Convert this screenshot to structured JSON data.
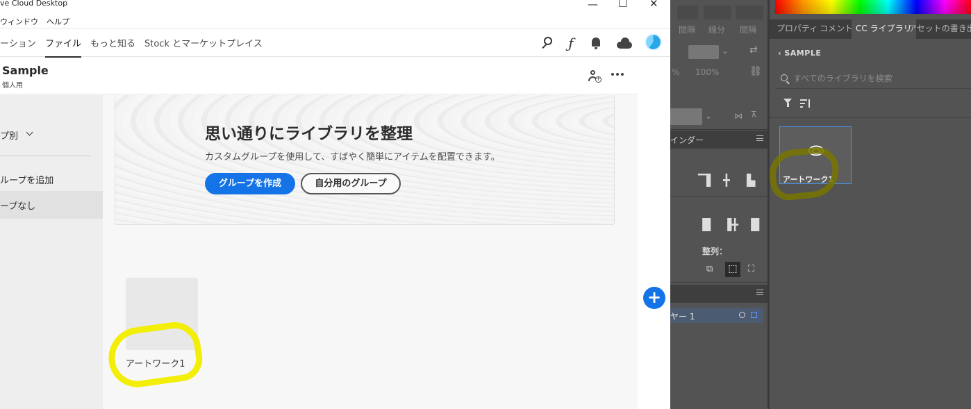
{
  "cc_window": {
    "title": "ve Cloud Desktop",
    "menu": [
      "ウィンドウ",
      "ヘルプ"
    ],
    "nav_tabs": [
      "ーション",
      "ファイル",
      "もっと知る",
      "Stock とマーケットプレイス"
    ],
    "nav_icons": [
      "search-icon",
      "fonts-icon",
      "bell-icon",
      "cloud-icon",
      "avatar"
    ],
    "library": {
      "name": "Sample",
      "subtitle": "個人用"
    },
    "leftnav": {
      "group_by": "プ別",
      "add_group": "ループを追加",
      "no_group": "ープなし"
    },
    "banner": {
      "title": "思い通りにライブラリを整理",
      "description": "カスタムグループを使用して、すばやく簡単にアイテムを配置できます。",
      "primary_button": "グループを作成",
      "secondary_button": "自分用のグループ"
    },
    "asset": {
      "name": "アートワーク1"
    },
    "fab_label": "+"
  },
  "illustrator": {
    "mid_labels": {
      "gap1": "間隔",
      "line": "線分",
      "gap2": "間隔",
      "pct1": "%",
      "pct2": "100%",
      "finder": "インダー",
      "align": "整列：",
      "layer": "ヤー 1"
    },
    "panel_tabs": [
      "プロパティ",
      "コメント",
      "CC ライブラリ",
      "アセットの書き出し"
    ],
    "active_tab": "CC ライブラリ",
    "library_back": "SAMPLE",
    "search_placeholder": "すべてのライブラリを検索",
    "card_name": "アートワーク1"
  },
  "colors": {
    "accent": "#1473e6",
    "highlight_yellow": "#f2ee07",
    "highlight_olive": "#787600",
    "selection_blue": "#4a90e2"
  }
}
